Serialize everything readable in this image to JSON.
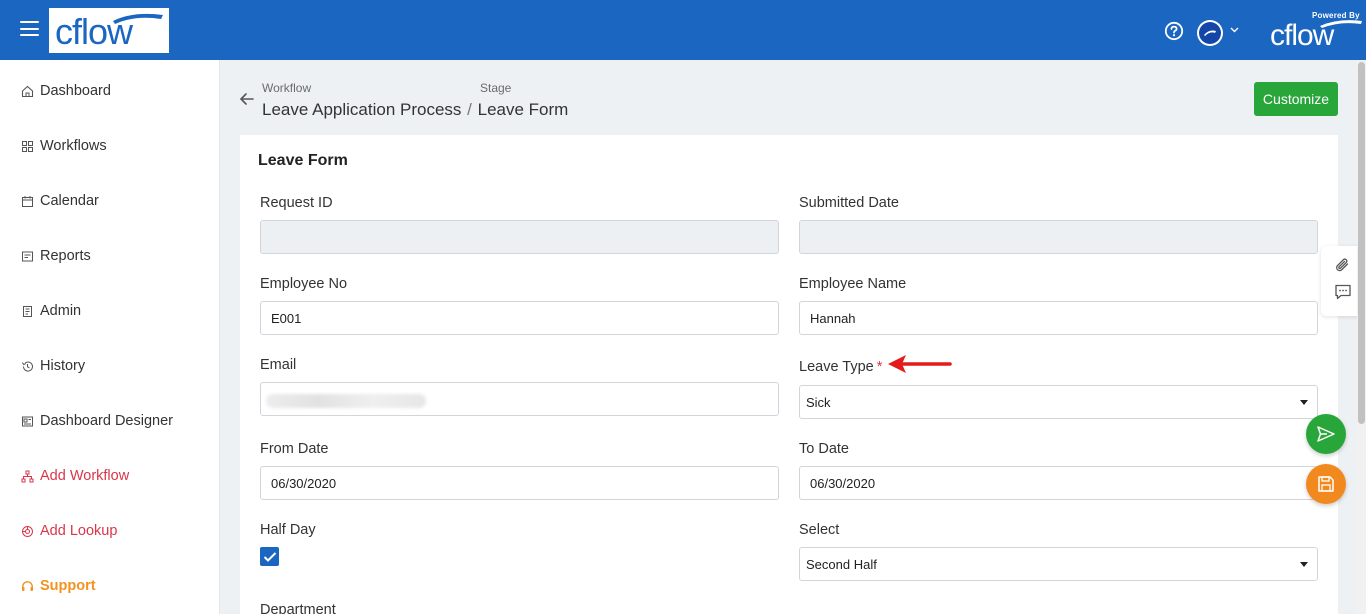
{
  "app": {
    "logo_text": "cflow",
    "powered_by": "Powered By",
    "powered_logo_text": "cflow"
  },
  "topbar": {
    "menu_icon": "hamburger-icon",
    "help_icon": "question-circle-icon",
    "avatar_icon": "user-avatar",
    "caret_icon": "chevron-down-icon"
  },
  "sidebar": {
    "items": [
      {
        "label": "Dashboard",
        "icon": "home-icon"
      },
      {
        "label": "Workflows",
        "icon": "grid-icon"
      },
      {
        "label": "Calendar",
        "icon": "calendar-icon"
      },
      {
        "label": "Reports",
        "icon": "report-icon"
      },
      {
        "label": "Admin",
        "icon": "admin-icon"
      },
      {
        "label": "History",
        "icon": "history-icon"
      },
      {
        "label": "Dashboard Designer",
        "icon": "designer-icon"
      },
      {
        "label": "Add Workflow",
        "icon": "sitemap-icon"
      },
      {
        "label": "Add Lookup",
        "icon": "lookup-icon"
      },
      {
        "label": "Support",
        "icon": "headset-icon"
      }
    ]
  },
  "header": {
    "workflow_label": "Workflow",
    "workflow_value": "Leave Application Process",
    "separator": "/",
    "stage_label": "Stage",
    "stage_value": "Leave Form",
    "customize_label": "Customize"
  },
  "form": {
    "title": "Leave Form",
    "request_id": {
      "label": "Request ID",
      "value": ""
    },
    "submitted_date": {
      "label": "Submitted Date",
      "value": ""
    },
    "employee_no": {
      "label": "Employee No",
      "value": "E001"
    },
    "employee_name": {
      "label": "Employee Name",
      "value": "Hannah"
    },
    "email": {
      "label": "Email",
      "value": ""
    },
    "leave_type": {
      "label": "Leave Type",
      "required_mark": "*",
      "value": "Sick"
    },
    "from_date": {
      "label": "From Date",
      "value": "06/30/2020"
    },
    "to_date": {
      "label": "To Date",
      "value": "06/30/2020"
    },
    "half_day": {
      "label": "Half Day",
      "checked": true
    },
    "select": {
      "label": "Select",
      "value": "Second Half"
    },
    "department": {
      "label": "Department"
    }
  },
  "colors": {
    "topbar": "#1a66c0",
    "accent_green": "#28a63a",
    "accent_orange": "#f2891f",
    "nav_red": "#d9364a",
    "support_orange": "#f2921f",
    "annotation_red": "#e41b1b"
  }
}
